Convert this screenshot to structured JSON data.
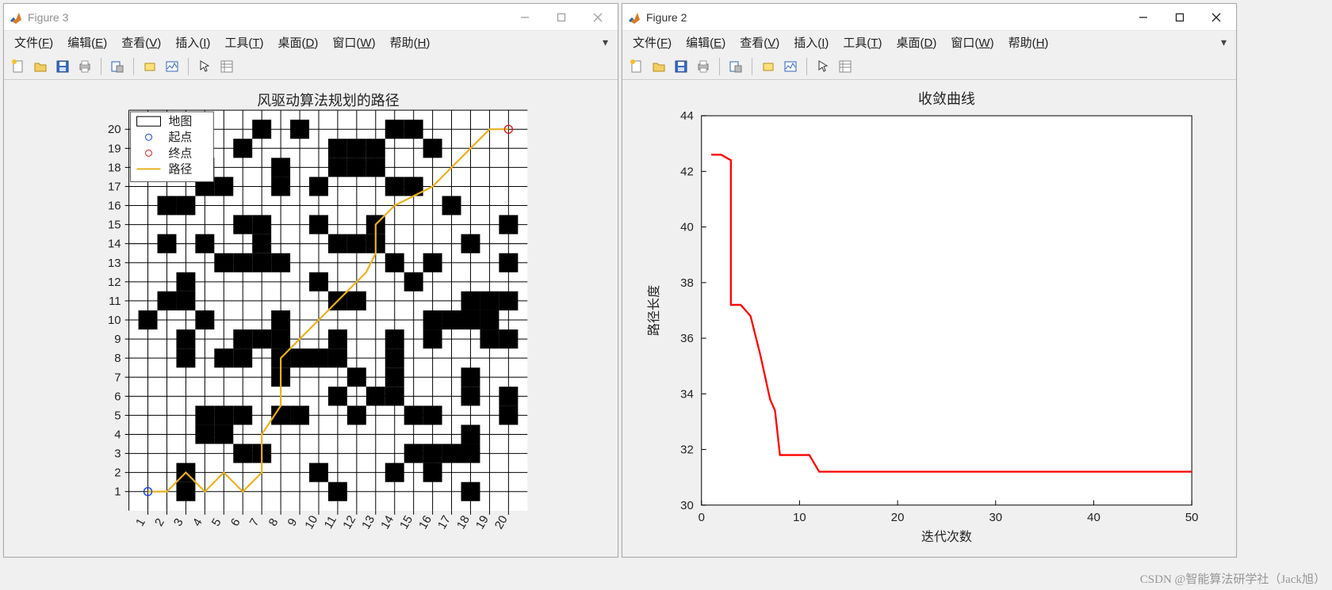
{
  "windows": {
    "fig3": {
      "title": "Figure 3"
    },
    "fig2": {
      "title": "Figure 2"
    }
  },
  "menu": {
    "file": {
      "text": "文件(",
      "ul": "F",
      "tail": ")"
    },
    "edit": {
      "text": "编辑(",
      "ul": "E",
      "tail": ")"
    },
    "view": {
      "text": "查看(",
      "ul": "V",
      "tail": ")"
    },
    "insert": {
      "text": "插入(",
      "ul": "I",
      "tail": ")"
    },
    "tools": {
      "text": "工具(",
      "ul": "T",
      "tail": ")"
    },
    "desktop": {
      "text": "桌面(",
      "ul": "D",
      "tail": ")"
    },
    "window": {
      "text": "窗口(",
      "ul": "W",
      "tail": ")"
    },
    "help": {
      "text": "帮助(",
      "ul": "H",
      "tail": ")"
    }
  },
  "toolbar_names": {
    "new": "new-figure-icon",
    "open": "open-icon",
    "save": "save-icon",
    "print": "print-icon",
    "page": "page-print-icon",
    "rotate": "rotate-icon",
    "linked": "linked-plot-icon",
    "pointer": "pointer-icon",
    "inspector": "inspector-icon"
  },
  "watermark": "CSDN @智能算法研学社（Jack旭）",
  "fig3_plot": {
    "title": "风驱动算法规划的路径",
    "legend": {
      "map": "地图",
      "start": "起点",
      "goal": "终点",
      "path": "路径"
    }
  },
  "fig2_plot": {
    "title": "收敛曲线",
    "xlabel": "迭代次数",
    "ylabel": "路径长度"
  },
  "chart_data": [
    {
      "type": "heatmap",
      "name": "grid_map_with_path",
      "title": "风驱动算法规划的路径",
      "xlabel": "",
      "ylabel": "",
      "grid_size": [
        20,
        20
      ],
      "x_ticks": [
        1,
        2,
        3,
        4,
        5,
        6,
        7,
        8,
        9,
        10,
        11,
        12,
        13,
        14,
        15,
        16,
        17,
        18,
        19,
        20
      ],
      "y_ticks": [
        1,
        2,
        3,
        4,
        5,
        6,
        7,
        8,
        9,
        10,
        11,
        12,
        13,
        14,
        15,
        16,
        17,
        18,
        19,
        20
      ],
      "obstacles": [
        [
          3,
          1
        ],
        [
          3,
          2
        ],
        [
          4,
          4
        ],
        [
          5,
          4
        ],
        [
          11,
          1
        ],
        [
          10,
          2
        ],
        [
          14,
          2
        ],
        [
          16,
          2
        ],
        [
          18,
          1
        ],
        [
          6,
          3
        ],
        [
          7,
          3
        ],
        [
          15,
          3
        ],
        [
          16,
          3
        ],
        [
          17,
          3
        ],
        [
          18,
          3
        ],
        [
          18,
          4
        ],
        [
          4,
          5
        ],
        [
          5,
          5
        ],
        [
          6,
          5
        ],
        [
          8,
          5
        ],
        [
          9,
          5
        ],
        [
          12,
          5
        ],
        [
          15,
          5
        ],
        [
          16,
          5
        ],
        [
          20,
          5
        ],
        [
          11,
          6
        ],
        [
          13,
          6
        ],
        [
          14,
          6
        ],
        [
          18,
          6
        ],
        [
          20,
          6
        ],
        [
          8,
          7
        ],
        [
          12,
          7
        ],
        [
          14,
          7
        ],
        [
          18,
          7
        ],
        [
          3,
          8
        ],
        [
          5,
          8
        ],
        [
          6,
          8
        ],
        [
          8,
          8
        ],
        [
          9,
          8
        ],
        [
          10,
          8
        ],
        [
          11,
          8
        ],
        [
          14,
          8
        ],
        [
          3,
          9
        ],
        [
          6,
          9
        ],
        [
          7,
          9
        ],
        [
          8,
          9
        ],
        [
          11,
          9
        ],
        [
          14,
          9
        ],
        [
          16,
          9
        ],
        [
          19,
          9
        ],
        [
          20,
          9
        ],
        [
          1,
          10
        ],
        [
          4,
          10
        ],
        [
          8,
          10
        ],
        [
          16,
          10
        ],
        [
          17,
          10
        ],
        [
          18,
          10
        ],
        [
          19,
          10
        ],
        [
          2,
          11
        ],
        [
          3,
          11
        ],
        [
          11,
          11
        ],
        [
          12,
          11
        ],
        [
          18,
          11
        ],
        [
          19,
          11
        ],
        [
          20,
          11
        ],
        [
          3,
          12
        ],
        [
          10,
          12
        ],
        [
          15,
          12
        ],
        [
          5,
          13
        ],
        [
          6,
          13
        ],
        [
          7,
          13
        ],
        [
          8,
          13
        ],
        [
          14,
          13
        ],
        [
          16,
          13
        ],
        [
          20,
          13
        ],
        [
          2,
          14
        ],
        [
          4,
          14
        ],
        [
          7,
          14
        ],
        [
          11,
          14
        ],
        [
          12,
          14
        ],
        [
          13,
          14
        ],
        [
          18,
          14
        ],
        [
          6,
          15
        ],
        [
          7,
          15
        ],
        [
          10,
          15
        ],
        [
          13,
          15
        ],
        [
          20,
          15
        ],
        [
          2,
          16
        ],
        [
          3,
          16
        ],
        [
          17,
          16
        ],
        [
          4,
          17
        ],
        [
          5,
          17
        ],
        [
          8,
          17
        ],
        [
          10,
          17
        ],
        [
          14,
          17
        ],
        [
          15,
          17
        ],
        [
          4,
          18
        ],
        [
          8,
          18
        ],
        [
          11,
          18
        ],
        [
          12,
          18
        ],
        [
          13,
          18
        ],
        [
          2,
          19
        ],
        [
          3,
          19
        ],
        [
          6,
          19
        ],
        [
          11,
          19
        ],
        [
          12,
          19
        ],
        [
          13,
          19
        ],
        [
          16,
          19
        ],
        [
          7,
          20
        ],
        [
          9,
          20
        ],
        [
          14,
          20
        ],
        [
          15,
          20
        ]
      ],
      "start": [
        1,
        1
      ],
      "goal": [
        20,
        20
      ],
      "series": [
        {
          "name": "路径",
          "type": "line",
          "values": [
            [
              1,
              1
            ],
            [
              2,
              1
            ],
            [
              3,
              2
            ],
            [
              4,
              1
            ],
            [
              5,
              2
            ],
            [
              6,
              1
            ],
            [
              7,
              2
            ],
            [
              7,
              4
            ],
            [
              8,
              5.5
            ],
            [
              8,
              8
            ],
            [
              9,
              9
            ],
            [
              10,
              10
            ],
            [
              11,
              11
            ],
            [
              12,
              12
            ],
            [
              12.5,
              12.5
            ],
            [
              13,
              13.5
            ],
            [
              13,
              15
            ],
            [
              14,
              16
            ],
            [
              15,
              16.5
            ],
            [
              16,
              17
            ],
            [
              17,
              18
            ],
            [
              18,
              19
            ],
            [
              19,
              20
            ],
            [
              20,
              20
            ]
          ]
        }
      ],
      "legend": [
        "地图",
        "起点",
        "终点",
        "路径"
      ]
    },
    {
      "type": "line",
      "name": "convergence_curve",
      "title": "收敛曲线",
      "xlabel": "迭代次数",
      "ylabel": "路径长度",
      "xlim": [
        0,
        50
      ],
      "ylim": [
        30,
        44
      ],
      "x_ticks": [
        0,
        10,
        20,
        30,
        40,
        50
      ],
      "y_ticks": [
        30,
        32,
        34,
        36,
        38,
        40,
        42,
        44
      ],
      "series": [
        {
          "name": "best",
          "type": "line",
          "color": "#ff0000",
          "values": [
            [
              1,
              42.6
            ],
            [
              2,
              42.6
            ],
            [
              3,
              42.4
            ],
            [
              3,
              37.2
            ],
            [
              4,
              37.2
            ],
            [
              5,
              36.8
            ],
            [
              6,
              35.4
            ],
            [
              7,
              33.8
            ],
            [
              7.5,
              33.4
            ],
            [
              8,
              31.8
            ],
            [
              11,
              31.8
            ],
            [
              12,
              31.2
            ],
            [
              50,
              31.2
            ]
          ]
        }
      ]
    }
  ]
}
